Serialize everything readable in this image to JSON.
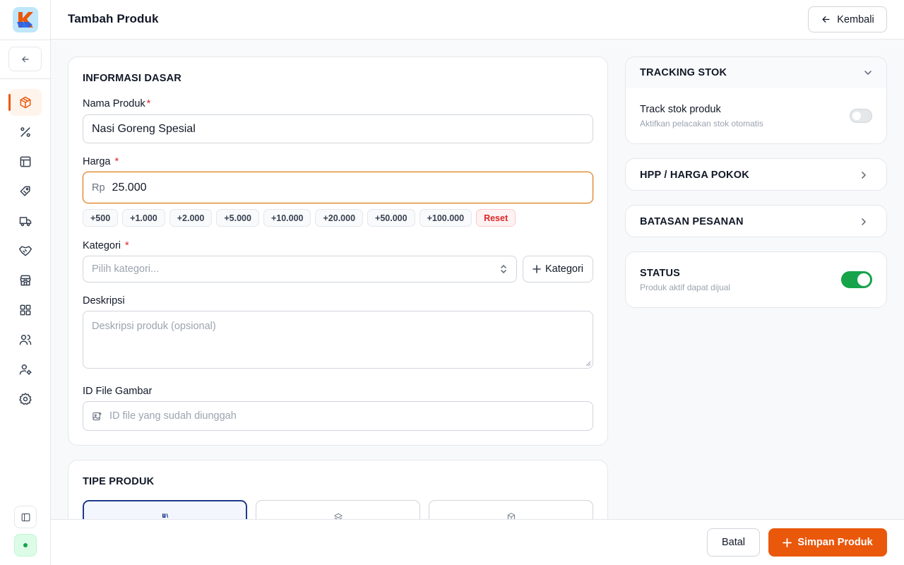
{
  "sidebar": {
    "logo_text": "K",
    "nav_icons": [
      "box-icon",
      "percent-icon",
      "layout-icon",
      "tag-icon",
      "truck-icon",
      "handshake-icon",
      "store-icon",
      "grid-icon",
      "users-icon",
      "user-cog-icon",
      "settings-icon"
    ],
    "active_index": 0
  },
  "header": {
    "title": "Tambah Produk",
    "back_label": "Kembali"
  },
  "info": {
    "title": "INFORMASI DASAR",
    "name_label": "Nama Produk",
    "name_value": "Nasi Goreng Spesial",
    "price_label": "Harga",
    "price_prefix": "Rp",
    "price_value": "25.000",
    "quick_amounts": [
      "+500",
      "+1.000",
      "+2.000",
      "+5.000",
      "+10.000",
      "+20.000",
      "+50.000",
      "+100.000"
    ],
    "reset_label": "Reset",
    "category_label": "Kategori",
    "category_placeholder": "Pilih kategori...",
    "add_category_label": "Kategori",
    "desc_label": "Deskripsi",
    "desc_placeholder": "Deskripsi produk (opsional)",
    "image_label": "ID File Gambar",
    "image_placeholder": "ID file yang sudah diunggah",
    "required_mark": "*"
  },
  "product_type": {
    "title": "TIPE PRODUK",
    "selected_index": 0
  },
  "tracking": {
    "title": "TRACKING STOK",
    "row_title": "Track stok produk",
    "row_sub": "Aktifkan pelacakan stok otomatis",
    "enabled": false
  },
  "hpp": {
    "title": "HPP / HARGA POKOK"
  },
  "order_limit": {
    "title": "BATASAN PESANAN"
  },
  "status": {
    "title": "STATUS",
    "sub": "Produk aktif dapat dijual",
    "enabled": true
  },
  "footer": {
    "cancel_label": "Batal",
    "save_label": "Simpan Produk"
  },
  "colors": {
    "accent": "#ea580c",
    "success": "#16a34a",
    "navy": "#1e3a8a"
  }
}
